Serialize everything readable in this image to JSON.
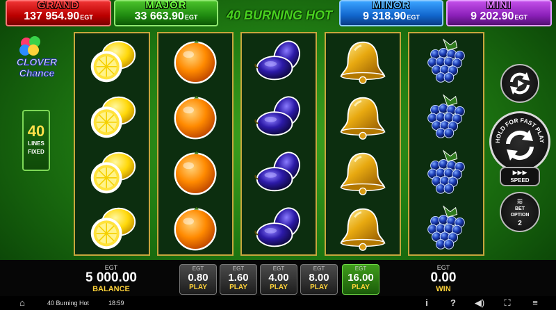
{
  "jackpots": [
    {
      "name": "GRAND",
      "value": "137 954.90",
      "unit": "EGT"
    },
    {
      "name": "MAJOR",
      "value": "33 663.90",
      "unit": "EGT"
    },
    {
      "name": "MINOR",
      "value": "9 318.90",
      "unit": "EGT"
    },
    {
      "name": "MINI",
      "value": "9 202.90",
      "unit": "EGT"
    }
  ],
  "game_title": "40 BURNING HOT",
  "logo": {
    "line1": "CLOVER",
    "line2": "Chance"
  },
  "lines": {
    "count": "40",
    "label1": "LINES",
    "label2": "FIXED"
  },
  "reels": [
    [
      "lemon",
      "lemon",
      "lemon",
      "lemon"
    ],
    [
      "orange",
      "orange",
      "orange",
      "orange"
    ],
    [
      "plum",
      "plum",
      "plum",
      "plum"
    ],
    [
      "bell",
      "bell",
      "bell",
      "bell"
    ],
    [
      "grapes",
      "grapes",
      "grapes",
      "grapes"
    ]
  ],
  "controls": {
    "spin_hint": "HOLD FOR FAST PLAY",
    "speed_label": "SPEED",
    "bet_option_label": "BET OPTION",
    "bet_option_value": "2"
  },
  "balance": {
    "currency": "EGT",
    "value": "5 000.00",
    "label": "BALANCE"
  },
  "bets": [
    {
      "currency": "EGT",
      "value": "0.80",
      "label": "PLAY",
      "active": false
    },
    {
      "currency": "EGT",
      "value": "1.60",
      "label": "PLAY",
      "active": false
    },
    {
      "currency": "EGT",
      "value": "4.00",
      "label": "PLAY",
      "active": false
    },
    {
      "currency": "EGT",
      "value": "8.00",
      "label": "PLAY",
      "active": false
    },
    {
      "currency": "EGT",
      "value": "16.00",
      "label": "PLAY",
      "active": true
    }
  ],
  "win": {
    "currency": "EGT",
    "value": "0.00",
    "label": "WIN"
  },
  "system_bar": {
    "game_name": "40 Burning Hot",
    "time": "18:59",
    "icons": [
      "home-icon",
      "info-icon",
      "help-icon",
      "sound-icon",
      "fullscreen-icon",
      "menu-icon"
    ]
  },
  "colors": {
    "grand": "#cc1111",
    "major": "#2a9a14",
    "minor": "#1a73d9",
    "mini": "#9a2ac8",
    "reel_border": "#c8a63d"
  }
}
